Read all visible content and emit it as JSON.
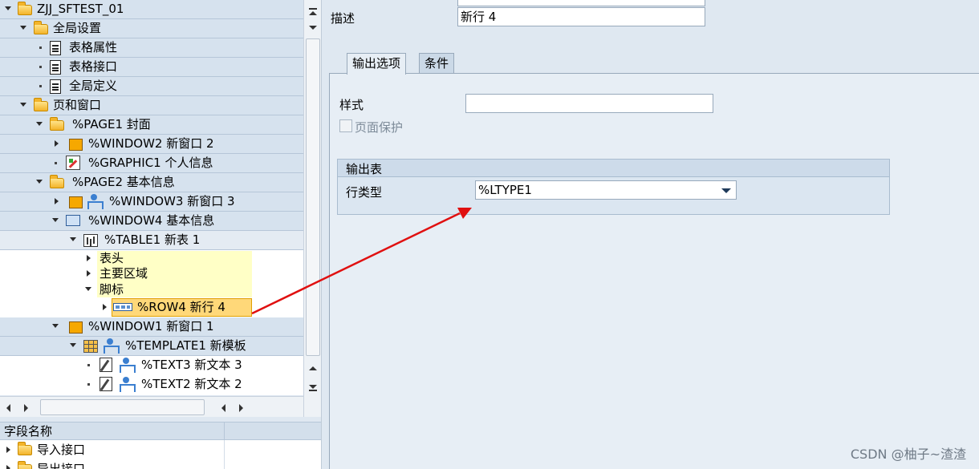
{
  "tree": {
    "root": "ZJJ_SFTEST_01",
    "global": "全局设置",
    "form_attr": "表格属性",
    "form_iface": "表格接口",
    "global_def": "全局定义",
    "pages_windows": "页和窗口",
    "page1": "%PAGE1 封面",
    "window2": "%WINDOW2 新窗口 2",
    "graphic1": "%GRAPHIC1 个人信息",
    "page2": "%PAGE2 基本信息",
    "window3": "%WINDOW3 新窗口 3",
    "window4": "%WINDOW4 基本信息",
    "table1": "%TABLE1 新表 1",
    "header": "表头",
    "main_area": "主要区域",
    "footer": "脚标",
    "row4": "%ROW4 新行 4",
    "window1": "%WINDOW1 新窗口 1",
    "template1": "%TEMPLATE1 新模板",
    "text3": "%TEXT3 新文本 3",
    "text2": "%TEXT2 新文本 2"
  },
  "fields": {
    "header": "字段名称",
    "items": [
      "导入接口",
      "导出接口"
    ]
  },
  "detail": {
    "desc_label": "描述",
    "desc_value": "新行 4",
    "tabs": [
      "输出选项",
      "条件"
    ],
    "style_label": "样式",
    "style_value": "",
    "page_protect": "页面保护",
    "output_table": "输出表",
    "line_type_label": "行类型",
    "line_type_value": "%LTYPE1"
  },
  "watermark": "CSDN @柚子~渣渣",
  "colors": {
    "selection": "#ffd879",
    "arrow": "#e01010",
    "panel": "#dfe8f1"
  }
}
